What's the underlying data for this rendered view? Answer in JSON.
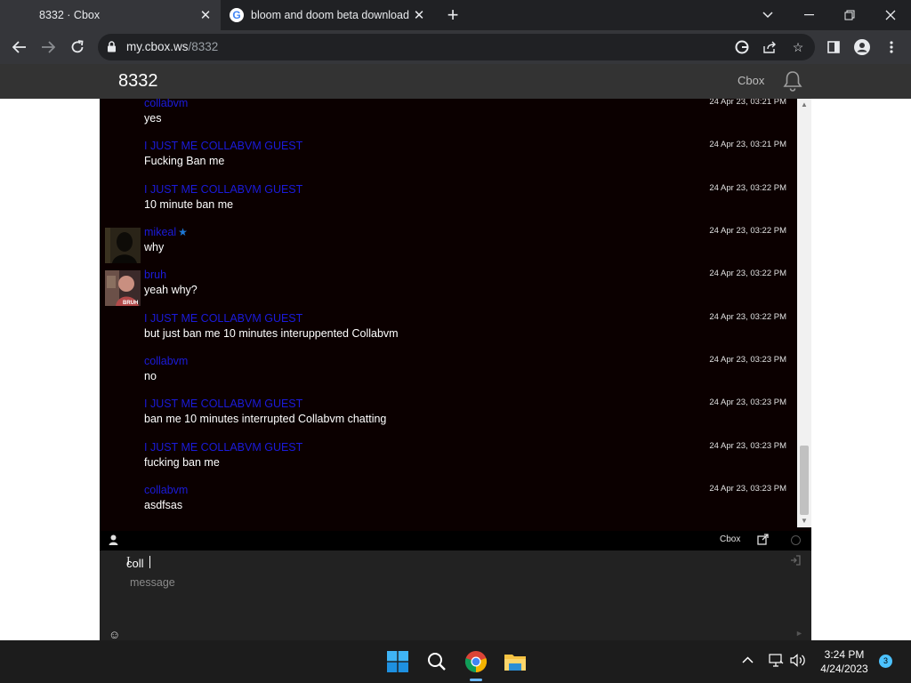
{
  "browser": {
    "tabs": [
      {
        "title": "8332 · Cbox",
        "active": true
      },
      {
        "title": "bloom and doom beta download",
        "active": false
      }
    ],
    "url_host": "my.cbox.ws",
    "url_path": "/8332"
  },
  "page": {
    "title": "8332",
    "cbox_link": "Cbox"
  },
  "messages": [
    {
      "name": "collabvm",
      "text": "yes",
      "time": "24 Apr 23, 03:21 PM",
      "avatar": null,
      "verified": false
    },
    {
      "name": "I JUST ME COLLABVM GUEST",
      "text": "Fucking Ban me",
      "time": "24 Apr 23, 03:21 PM",
      "avatar": null,
      "verified": false
    },
    {
      "name": "I JUST ME COLLABVM GUEST",
      "text": "10 minute ban me",
      "time": "24 Apr 23, 03:22 PM",
      "avatar": null,
      "verified": false
    },
    {
      "name": "mikeal",
      "text": "why",
      "time": "24 Apr 23, 03:22 PM",
      "avatar": "dark-figure",
      "verified": true
    },
    {
      "name": "bruh",
      "text": "yeah why?",
      "time": "24 Apr 23, 03:22 PM",
      "avatar": "bruh-meme",
      "verified": false
    },
    {
      "name": "I JUST ME COLLABVM GUEST",
      "text": "but just ban me 10 minutes interuppented Collabvm",
      "time": "24 Apr 23, 03:22 PM",
      "avatar": null,
      "verified": false
    },
    {
      "name": "collabvm",
      "text": "no",
      "time": "24 Apr 23, 03:23 PM",
      "avatar": null,
      "verified": false
    },
    {
      "name": "I JUST ME COLLABVM GUEST",
      "text": "ban me 10 minutes interrupted Collabvm chatting",
      "time": "24 Apr 23, 03:23 PM",
      "avatar": null,
      "verified": false
    },
    {
      "name": "I JUST ME COLLABVM GUEST",
      "text": "fucking ban me",
      "time": "24 Apr 23, 03:23 PM",
      "avatar": null,
      "verified": false
    },
    {
      "name": "collabvm",
      "text": "asdfsas",
      "time": "24 Apr 23, 03:23 PM",
      "avatar": null,
      "verified": false
    }
  ],
  "avatar_labels": {
    "bruh": "BRUH"
  },
  "statusbar": {
    "cbox_label": "Cbox"
  },
  "composer": {
    "name_value": "coll",
    "message_value": "",
    "message_placeholder": "message"
  },
  "taskbar": {
    "time": "3:24 PM",
    "date": "4/24/2023",
    "notification_count": "3"
  },
  "colors": {
    "chat_bg": "#0b0000",
    "name_color": "#1b1bdb",
    "header_bg": "#333333",
    "composer_bg": "#222222"
  }
}
